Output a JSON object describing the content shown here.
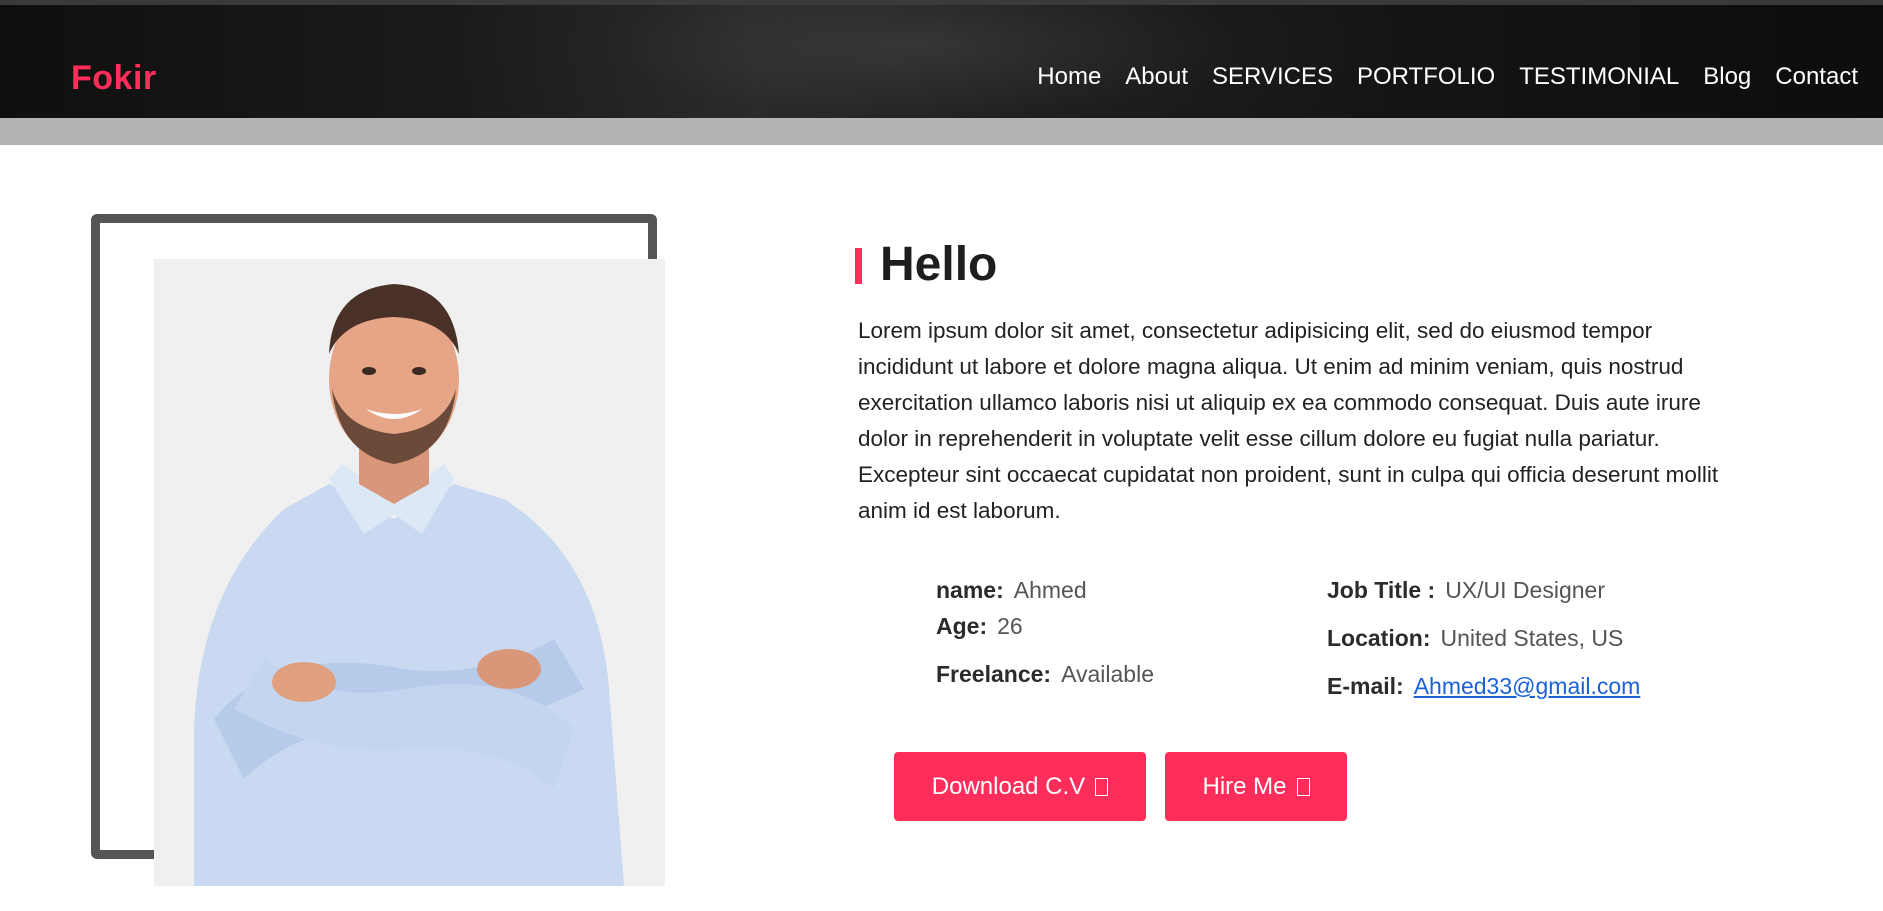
{
  "brand": {
    "logo": "Fokir",
    "accent": "#ff2d5a"
  },
  "nav": {
    "items": [
      "Home",
      "About",
      "SERVICES",
      "PORTFOLIO",
      "TESTIMONIAL",
      "Blog",
      "Contact"
    ]
  },
  "about": {
    "heading": "Hello",
    "intro": "Lorem ipsum dolor sit amet, consectetur adipisicing elit, sed do eiusmod tempor incididunt ut labore et dolore magna aliqua. Ut enim ad minim veniam, quis nostrud exercitation ullamco laboris nisi ut aliquip ex ea commodo consequat. Duis aute irure dolor in reprehenderit in voluptate velit esse cillum dolore eu fugiat nulla pariatur. Excepteur sint occaecat cupidatat non proident, sunt in culpa qui officia deserunt mollit anim id est laborum.",
    "info_left": [
      {
        "label": "name:",
        "value": "Ahmed"
      },
      {
        "label": "Age:",
        "value": "26"
      },
      {
        "label": "Freelance:",
        "value": "Available"
      }
    ],
    "info_right": [
      {
        "label": "Job Title :",
        "value": "UX/UI Designer"
      },
      {
        "label": "Location:",
        "value": "United States, US"
      },
      {
        "label": "E-mail:",
        "value": "Ahmed33@gmail.com"
      }
    ],
    "buttons": {
      "download": "Download C.V",
      "hire": "Hire Me"
    }
  }
}
